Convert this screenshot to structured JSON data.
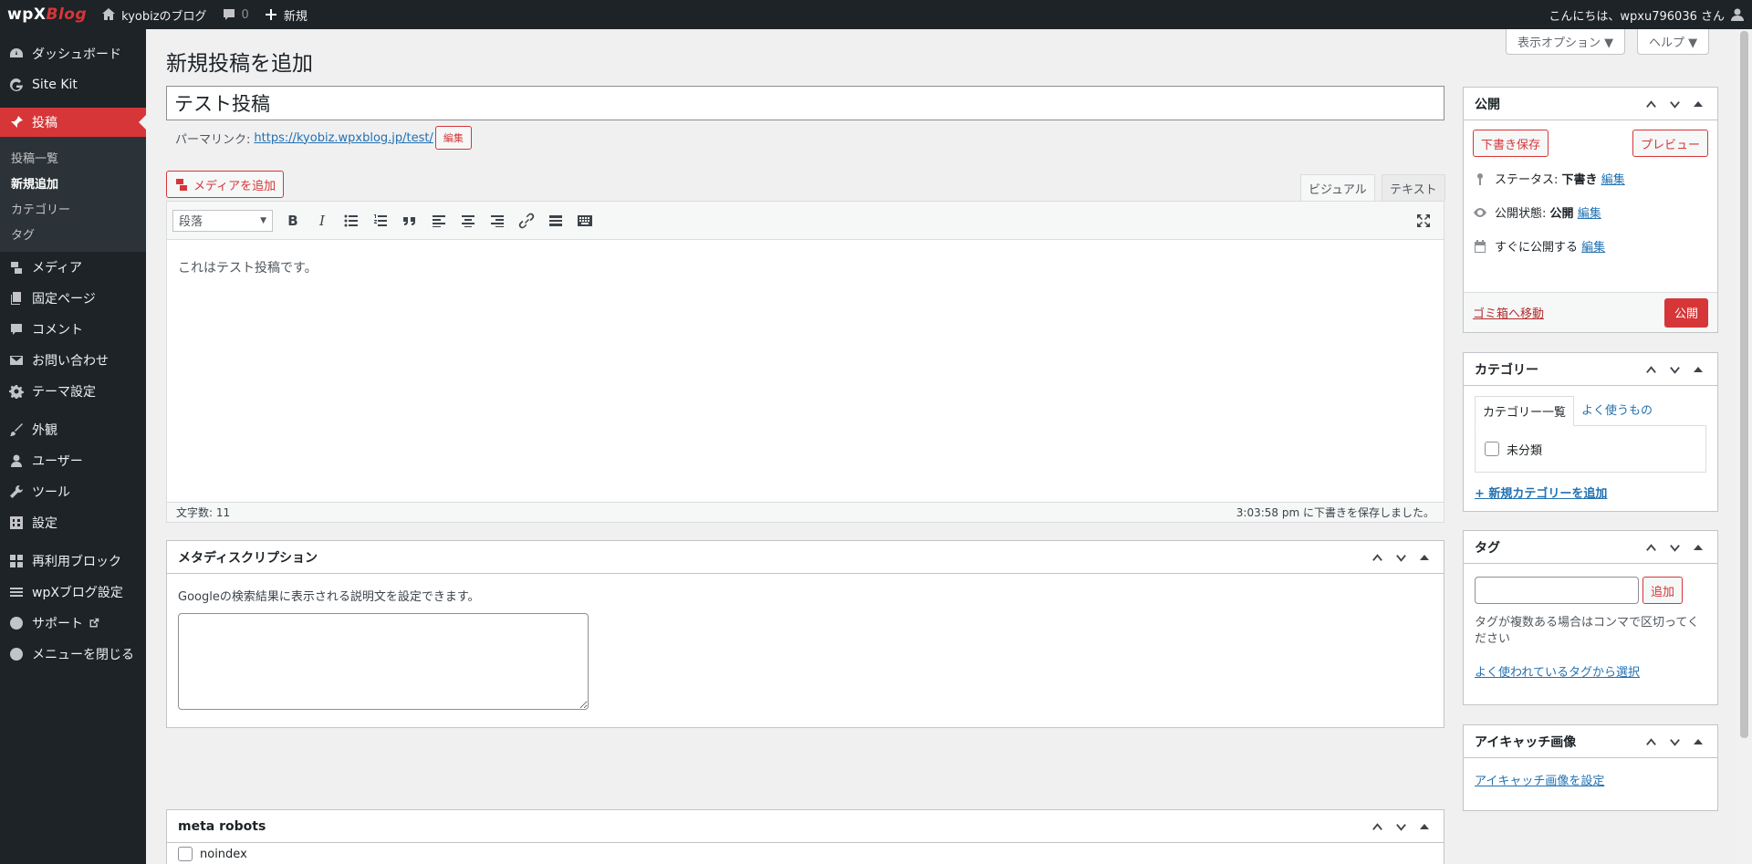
{
  "adminbar": {
    "logo_wp": "wpX",
    "logo_blog": "Blog",
    "site_name": "kyobizのブログ",
    "comments_count": "0",
    "new_label": "新規",
    "greeting": "こんにちは、wpxu796036 さん"
  },
  "sidebar": {
    "items": [
      {
        "label": "ダッシュボード",
        "icon": "dashboard-icon"
      },
      {
        "label": "Site Kit",
        "icon": "google-icon"
      },
      {
        "label": "投稿",
        "icon": "pin-icon"
      },
      {
        "label": "メディア",
        "icon": "media-icon"
      },
      {
        "label": "固定ページ",
        "icon": "page-icon"
      },
      {
        "label": "コメント",
        "icon": "comment-icon"
      },
      {
        "label": "お問い合わせ",
        "icon": "mail-icon"
      },
      {
        "label": "テーマ設定",
        "icon": "gear-icon"
      },
      {
        "label": "外観",
        "icon": "brush-icon"
      },
      {
        "label": "ユーザー",
        "icon": "user-icon"
      },
      {
        "label": "ツール",
        "icon": "wrench-icon"
      },
      {
        "label": "設定",
        "icon": "settings-icon"
      },
      {
        "label": "再利用ブロック",
        "icon": "blocks-icon"
      },
      {
        "label": "wpXブログ設定",
        "icon": "menu-icon"
      },
      {
        "label": "サポート",
        "icon": "help-icon"
      },
      {
        "label": "メニューを閉じる",
        "icon": "collapse-icon"
      }
    ],
    "submenu": [
      "投稿一覧",
      "新規追加",
      "カテゴリー",
      "タグ"
    ]
  },
  "header": {
    "page_title": "新規投稿を追加",
    "screen_options": "表示オプション ▼",
    "help": "ヘルプ ▼"
  },
  "post": {
    "title": "テスト投稿",
    "permalink_label": "パーマリンク:",
    "permalink_url": "https://kyobiz.wpxblog.jp/test/",
    "edit_label": "編集",
    "add_media": "メディアを追加",
    "tab_visual": "ビジュアル",
    "tab_text": "テキスト",
    "format": "段落",
    "content": "これはテスト投稿です。",
    "word_count": "文字数: 11",
    "draft_saved": "3:03:58 pm に下書きを保存しました。"
  },
  "meta_desc": {
    "title": "メタディスクリプション",
    "description": "Googleの検索結果に表示される説明文を設定できます。"
  },
  "meta_robots": {
    "title": "meta robots",
    "noindex": "noindex"
  },
  "publish": {
    "title": "公開",
    "save_draft": "下書き保存",
    "preview": "プレビュー",
    "status_label": "ステータス:",
    "status_value": "下書き",
    "visibility_label": "公開状態:",
    "visibility_value": "公開",
    "schedule": "すぐに公開する",
    "edit": "編集",
    "trash": "ゴミ箱へ移動",
    "publish_btn": "公開"
  },
  "categories": {
    "title": "カテゴリー",
    "tab_all": "カテゴリー一覧",
    "tab_popular": "よく使うもの",
    "item": "未分類",
    "add_new": "+ 新規カテゴリーを追加"
  },
  "tags": {
    "title": "タグ",
    "add": "追加",
    "hint": "タグが複数ある場合はコンマで区切ってください",
    "choose": "よく使われているタグから選択"
  },
  "featured": {
    "title": "アイキャッチ画像",
    "set": "アイキャッチ画像を設定"
  },
  "colors": {
    "accent": "#d63638",
    "adminbar": "#1d2327",
    "link": "#2271b1"
  }
}
